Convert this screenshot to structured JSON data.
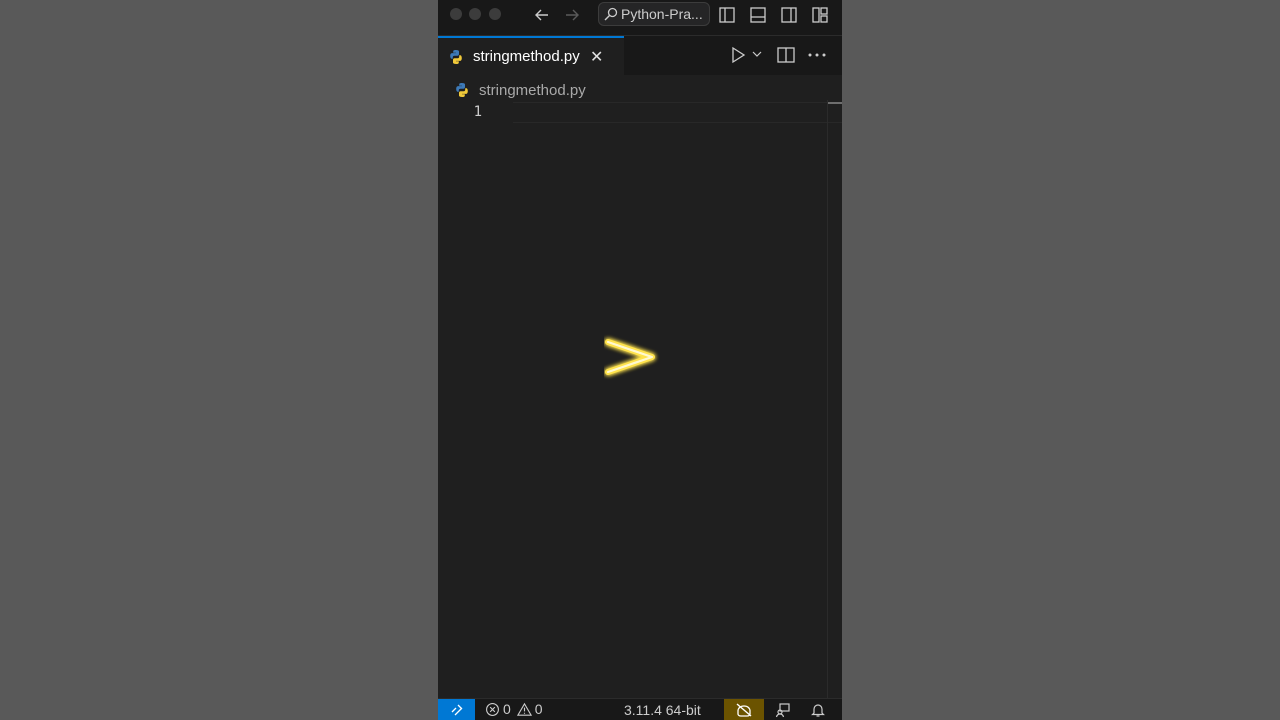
{
  "titlebar": {
    "command_center_label": "Python-Pra..."
  },
  "tabs": [
    {
      "label": "stringmethod.py",
      "close_glyph": "✕",
      "active": true
    }
  ],
  "breadcrumb": {
    "file_label": "stringmethod.py"
  },
  "editor": {
    "line_numbers": [
      "1"
    ]
  },
  "statusbar": {
    "errors_count": "0",
    "warnings_count": "0",
    "interpreter_label": "3.11.4 64-bit"
  },
  "icons": {
    "back": "arrow-left-icon",
    "forward": "arrow-right-icon",
    "search": "search-icon",
    "python": "python-icon",
    "run": "play-icon",
    "split": "split-editor-icon",
    "more": "ellipsis-icon",
    "bell": "bell-icon"
  },
  "colors": {
    "accent": "#0078d4",
    "editor_bg": "#1f1f1f",
    "chrome_bg": "#181818",
    "glow": "#ffe34d",
    "copilot_bg": "#6b5300"
  }
}
